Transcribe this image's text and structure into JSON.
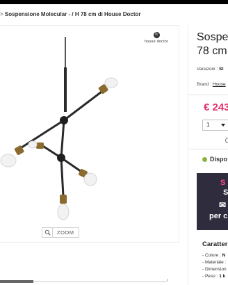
{
  "breadcrumb": {
    "separator": ">",
    "current": "Sospensione Molecular - / H 78 cm di House Doctor"
  },
  "brand_logo": {
    "mark": "h",
    "text": "house doctor"
  },
  "zoom": {
    "label": "ZOOM"
  },
  "product": {
    "title_line1": "Sospe",
    "title_line2": "78 cm",
    "variazioni_label": "Variazoni :",
    "variazioni_value": "St",
    "brand_label": "Brand :",
    "brand_value": "House",
    "price": "€ 243",
    "quantity": "1",
    "availability": "Dispo"
  },
  "promo": {
    "line1": "S",
    "line2": "S",
    "line3": "✉",
    "line4": "per c"
  },
  "characteristics": {
    "title": "Caratteri",
    "items": [
      {
        "label": "- Colore :",
        "value": "N"
      },
      {
        "label": "- Materiale :",
        "value": ""
      },
      {
        "label": "- Dimension",
        "value": ""
      },
      {
        "label": "- Peso :",
        "value": "1 k"
      }
    ]
  },
  "colors": {
    "price": "#e4326b",
    "promo_bg": "#2e2c3d",
    "promo_accent": "#ff4a8a",
    "availability_dot": "#8cb33f"
  }
}
